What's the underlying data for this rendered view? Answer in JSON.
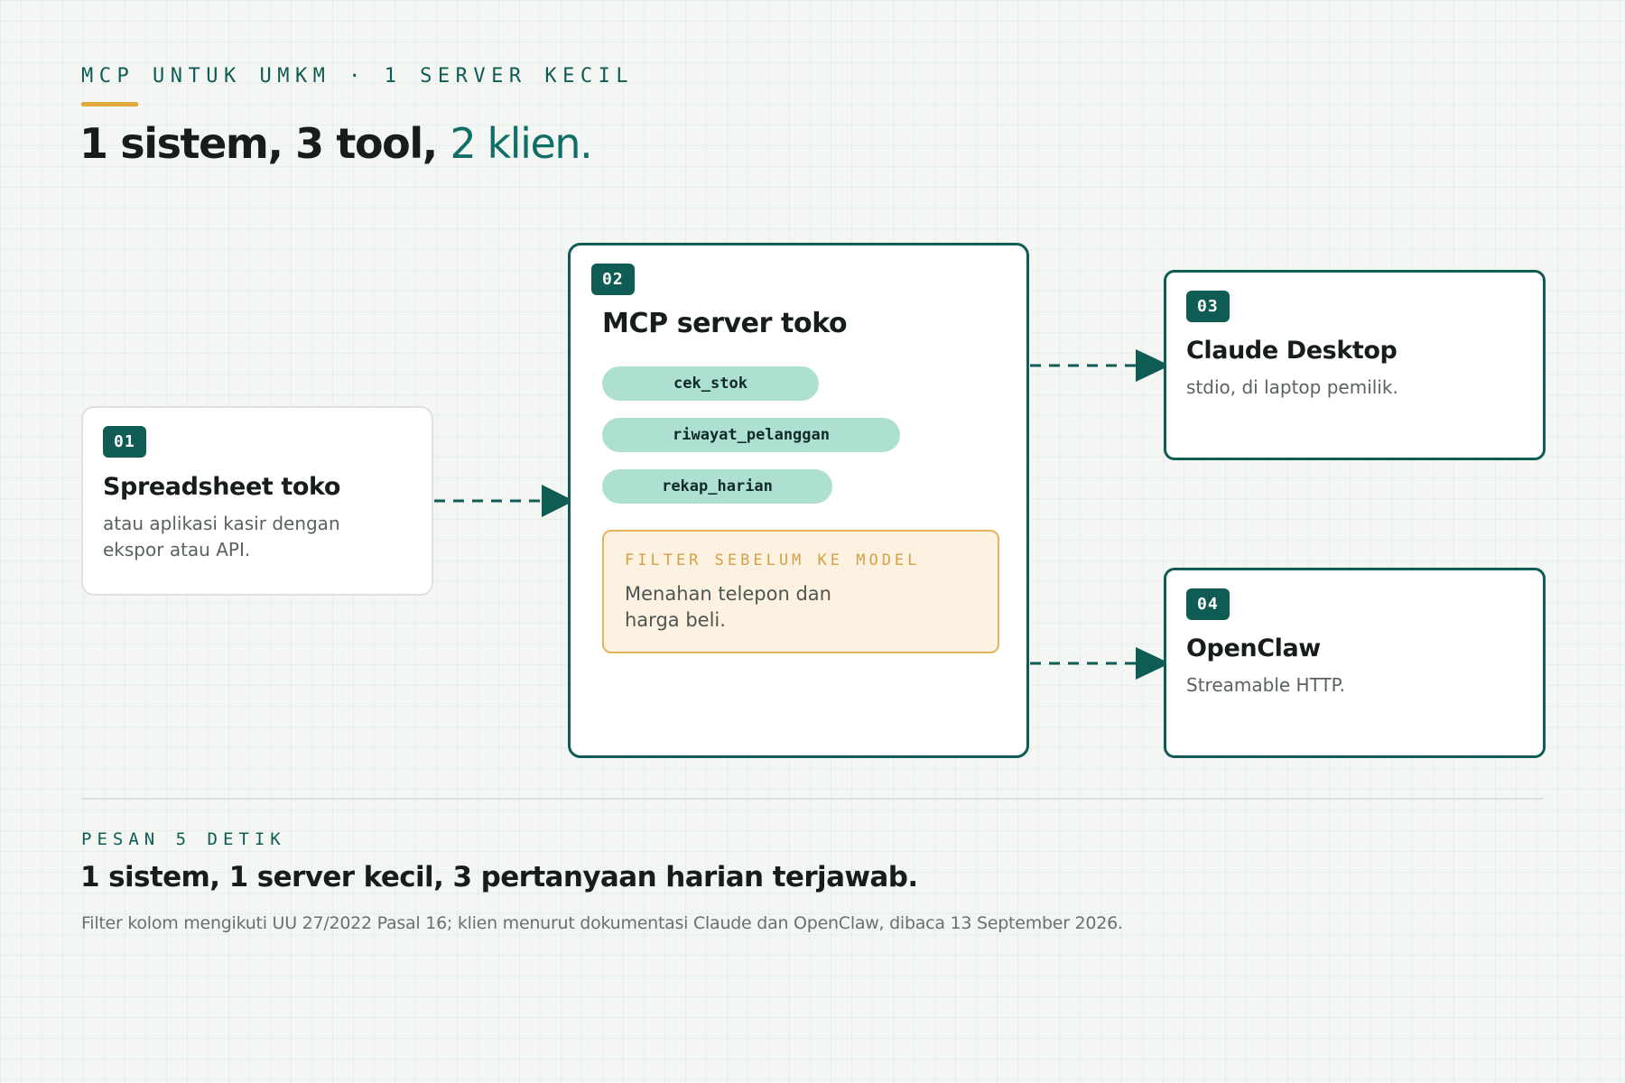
{
  "header": {
    "kicker": "MCP UNTUK UMKM · 1 SERVER KECIL",
    "title_main": "1 sistem, 3 tool, ",
    "title_accent": "2 klien."
  },
  "nodes": {
    "source": {
      "badge": "01",
      "title": "Spreadsheet toko",
      "description": "atau aplikasi kasir dengan ekspor atau API."
    },
    "server": {
      "badge": "02",
      "title": "MCP server toko",
      "tools": [
        "cek_stok",
        "riwayat_pelanggan",
        "rekap_harian"
      ],
      "filter": {
        "label": "FILTER SEBELUM KE MODEL",
        "description": "Menahan telepon dan harga beli."
      }
    },
    "clients": [
      {
        "badge": "03",
        "title": "Claude Desktop",
        "description": "stdio, di laptop pemilik."
      },
      {
        "badge": "04",
        "title": "OpenClaw",
        "description": "Streamable HTTP."
      }
    ]
  },
  "edges": [
    {
      "from": "01",
      "to": "02",
      "style": "dashed"
    },
    {
      "from": "02",
      "to": "03",
      "style": "dashed"
    },
    {
      "from": "02",
      "to": "04",
      "style": "dashed"
    }
  ],
  "message": {
    "label": "PESAN 5 DETIK",
    "title": "1 sistem, 1 server kecil, 3 pertanyaan harian terjawab.",
    "note": "Filter kolom mengikuti UU 27/2022 Pasal 16; klien menurut dokumentasi Claude dan OpenClaw, dibaca 13 September 2026."
  },
  "colors": {
    "primary": "#0f5c54",
    "accent": "#e0a93a",
    "tool_pill": "#aee0d2",
    "filter_background": "#fdf1e2",
    "filter_border": "#e6b25a",
    "background": "#f4f6f3"
  }
}
